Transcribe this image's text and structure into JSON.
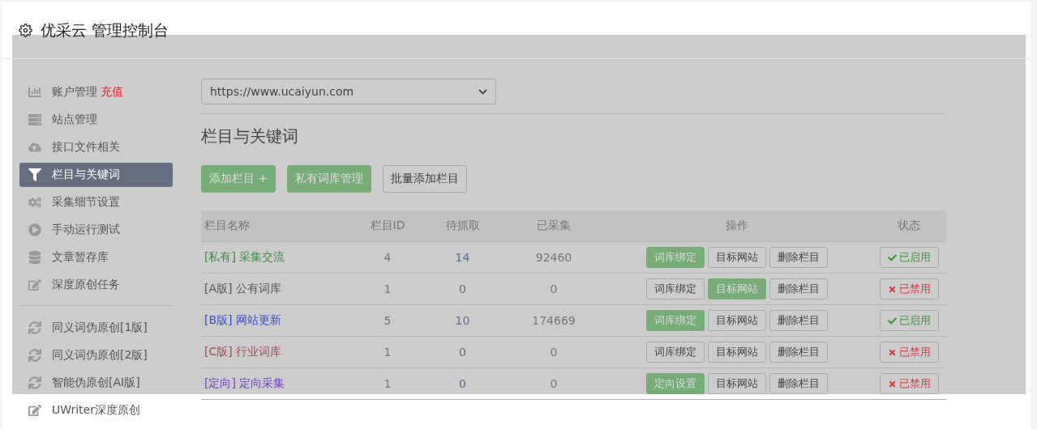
{
  "header": {
    "title": "优采云 管理控制台"
  },
  "sidebar": {
    "groups": [
      {
        "items": [
          {
            "label": "账户管理",
            "badge": "充值",
            "selected": false
          },
          {
            "label": "站点管理",
            "selected": false
          },
          {
            "label": "接口文件相关",
            "selected": false
          },
          {
            "label": "栏目与关键词",
            "selected": true
          },
          {
            "label": "采集细节设置",
            "selected": false
          },
          {
            "label": "手动运行测试",
            "selected": false
          },
          {
            "label": "文章暂存库",
            "selected": false
          },
          {
            "label": "深度原创任务",
            "selected": false
          }
        ]
      },
      {
        "items": [
          {
            "label": "同义词伪原创[1版]",
            "selected": false
          },
          {
            "label": "同义词伪原创[2版]",
            "selected": false
          },
          {
            "label": "智能伪原创[AI版]",
            "selected": false
          },
          {
            "label": "UWriter深度原创",
            "selected": false
          }
        ]
      }
    ]
  },
  "site_select": {
    "value": "https://www.ucaiyun.com"
  },
  "heading": "栏目与关键词",
  "toolbar": [
    {
      "label": "添加栏目 +",
      "primary": true
    },
    {
      "label": "私有词库管理",
      "primary": true
    },
    {
      "label": "批量添加栏目",
      "primary": false
    }
  ],
  "table": {
    "columns": [
      "栏目名称",
      "栏目ID",
      "待抓取",
      "已采集",
      "操作",
      "状态"
    ],
    "rows": [
      {
        "name": "[私有] 采集交流",
        "color": "#3c8c3c",
        "id": "4",
        "pending": "14",
        "collected": "92460",
        "actions": [
          {
            "label": "词库绑定",
            "primary": true
          },
          {
            "label": "目标网站",
            "primary": false
          },
          {
            "label": "删除栏目",
            "primary": false
          }
        ],
        "status": "已启用",
        "enabled": true
      },
      {
        "name": "[A版] 公有词库",
        "color": "#555555",
        "id": "1",
        "pending": "0",
        "collected": "0",
        "actions": [
          {
            "label": "词库绑定",
            "primary": false
          },
          {
            "label": "目标网站",
            "primary": true
          },
          {
            "label": "删除栏目",
            "primary": false
          }
        ],
        "status": "已禁用",
        "enabled": false
      },
      {
        "name": "[B版] 网站更新",
        "color": "#3a50c8",
        "id": "5",
        "pending": "10",
        "collected": "174669",
        "actions": [
          {
            "label": "词库绑定",
            "primary": true
          },
          {
            "label": "目标网站",
            "primary": false
          },
          {
            "label": "删除栏目",
            "primary": false
          }
        ],
        "status": "已启用",
        "enabled": true
      },
      {
        "name": "[C版] 行业词库",
        "color": "#a84858",
        "id": "1",
        "pending": "0",
        "collected": "0",
        "actions": [
          {
            "label": "词库绑定",
            "primary": false
          },
          {
            "label": "目标网站",
            "primary": false
          },
          {
            "label": "删除栏目",
            "primary": false
          }
        ],
        "status": "已禁用",
        "enabled": false
      },
      {
        "name": "[定向] 定向采集",
        "color": "#7040c8",
        "id": "1",
        "pending": "0",
        "collected": "0",
        "actions": [
          {
            "label": "定向设置",
            "primary": true
          },
          {
            "label": "目标网站",
            "primary": false
          },
          {
            "label": "删除栏目",
            "primary": false
          }
        ],
        "status": "已禁用",
        "enabled": false
      }
    ]
  }
}
